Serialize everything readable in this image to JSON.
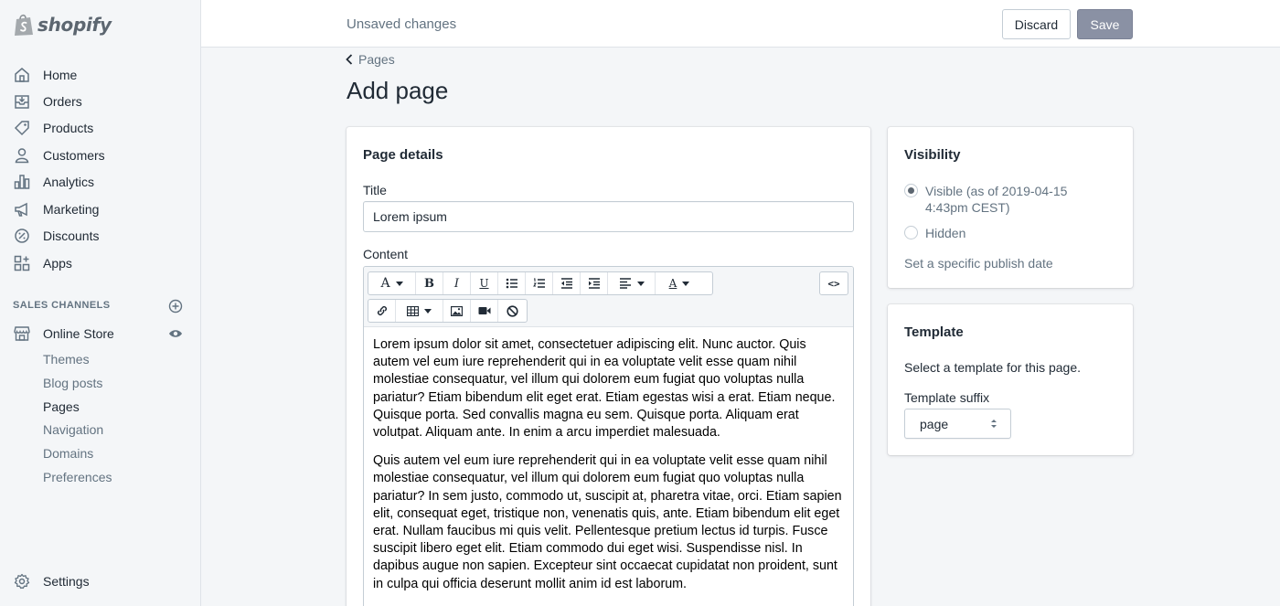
{
  "brand": {
    "name": "shopify",
    "logo_color": "#95bf47"
  },
  "sidebar": {
    "items": [
      {
        "label": "Home",
        "icon": "home-icon"
      },
      {
        "label": "Orders",
        "icon": "orders-icon"
      },
      {
        "label": "Products",
        "icon": "tag-icon"
      },
      {
        "label": "Customers",
        "icon": "person-icon"
      },
      {
        "label": "Analytics",
        "icon": "bar-chart-icon"
      },
      {
        "label": "Marketing",
        "icon": "megaphone-icon"
      },
      {
        "label": "Discounts",
        "icon": "discount-icon"
      },
      {
        "label": "Apps",
        "icon": "apps-icon"
      }
    ],
    "sales_channels_label": "SALES CHANNELS",
    "online_store": {
      "label": "Online Store",
      "sub_items": [
        "Themes",
        "Blog posts",
        "Pages",
        "Navigation",
        "Domains",
        "Preferences"
      ],
      "active": "Pages"
    },
    "settings_label": "Settings"
  },
  "topbar": {
    "status": "Unsaved changes",
    "discard_label": "Discard",
    "save_label": "Save"
  },
  "header": {
    "breadcrumb": "Pages",
    "title": "Add page"
  },
  "page_details": {
    "heading": "Page details",
    "title_label": "Title",
    "title_value": "Lorem ipsum",
    "content_label": "Content",
    "toolbar_row1": [
      "font-icon",
      "bold-icon",
      "italic-icon",
      "underline-icon",
      "bullet-list-icon",
      "numbered-list-icon",
      "outdent-icon",
      "indent-icon",
      "align-icon",
      "text-color-icon",
      "html-code-icon"
    ],
    "toolbar_row2": [
      "link-icon",
      "table-icon",
      "image-icon",
      "video-icon",
      "clear-formatting-icon"
    ],
    "paragraphs": [
      "Lorem ipsum dolor sit amet, consectetuer adipiscing elit. Nunc auctor. Quis autem vel eum iure reprehenderit qui in ea voluptate velit esse quam nihil molestiae consequatur, vel illum qui dolorem eum fugiat quo voluptas nulla pariatur? Etiam bibendum elit eget erat. Etiam egestas wisi a erat. Etiam neque. Quisque porta. Sed convallis magna eu sem. Quisque porta. Aliquam erat volutpat. Aliquam ante. In enim a arcu imperdiet malesuada.",
      "Quis autem vel eum iure reprehenderit qui in ea voluptate velit esse quam nihil molestiae consequatur, vel illum qui dolorem eum fugiat quo voluptas nulla pariatur? In sem justo, commodo ut, suscipit at, pharetra vitae, orci. Etiam sapien elit, consequat eget, tristique non, venenatis quis, ante. Etiam bibendum elit eget erat. Nullam faucibus mi quis velit. Pellentesque pretium lectus id turpis. Fusce suscipit libero eget elit. Etiam commodo dui eget wisi. Suspendisse nisl. In dapibus augue non sapien. Excepteur sint occaecat cupidatat non proident, sunt in culpa qui officia deserunt mollit anim id est laborum."
    ]
  },
  "visibility": {
    "heading": "Visibility",
    "visible_label": "Visible (as of 2019-04-15 4:43pm CEST)",
    "hidden_label": "Hidden",
    "selected": "visible",
    "publish_link": "Set a specific publish date"
  },
  "template": {
    "heading": "Template",
    "description": "Select a template for this page.",
    "suffix_label": "Template suffix",
    "suffix_value": "page"
  }
}
